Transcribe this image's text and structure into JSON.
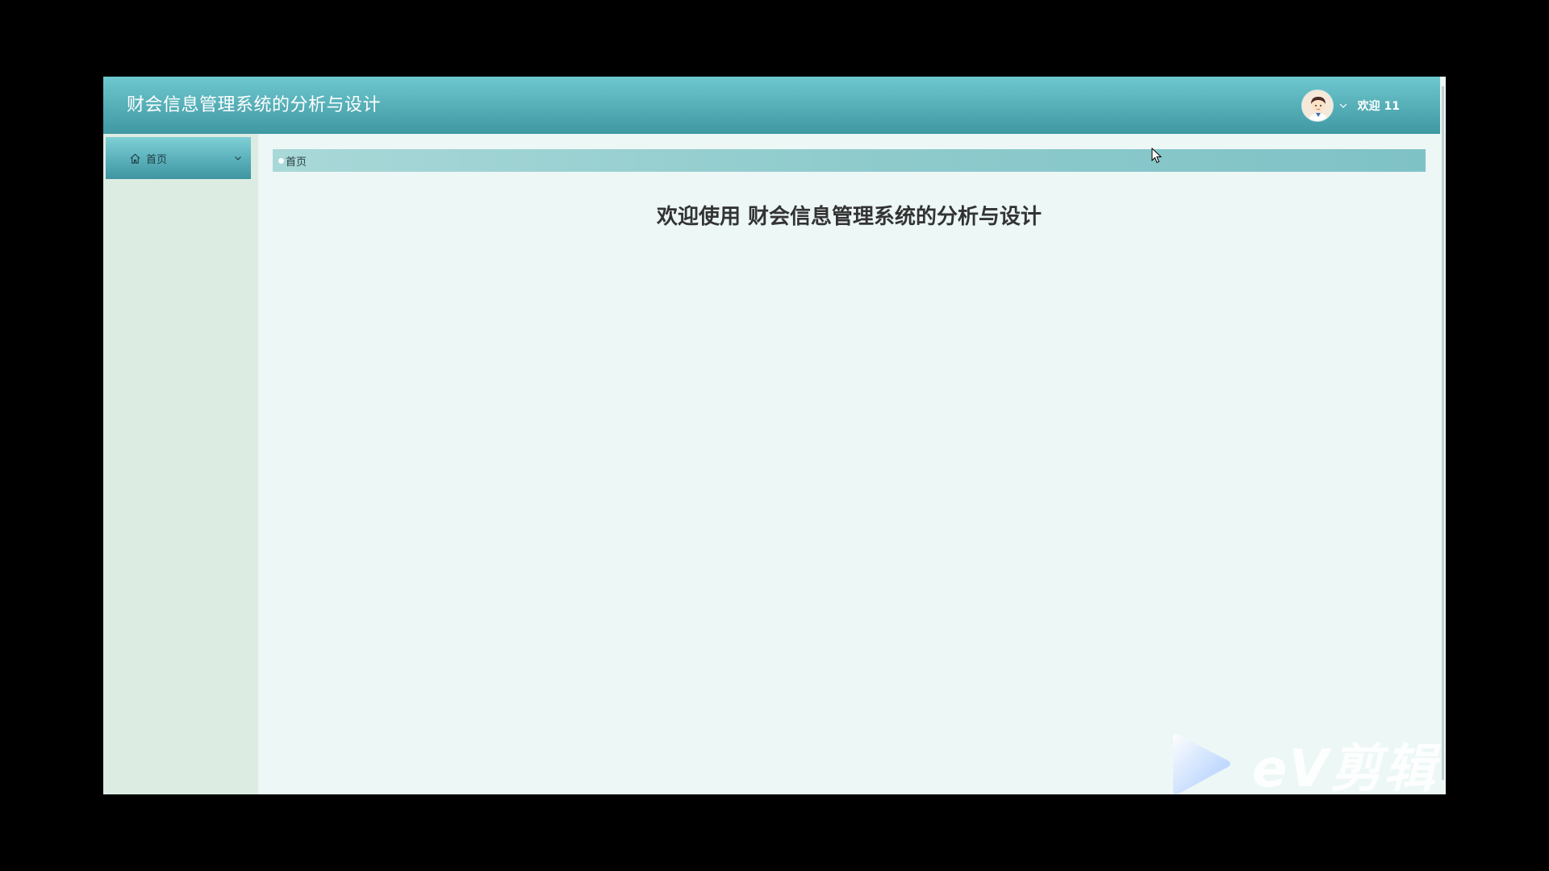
{
  "header": {
    "title": "财会信息管理系统的分析与设计",
    "welcome_user": "欢迎 11",
    "avatar_icon": "user-avatar-icon",
    "user_menu_icon": "chevron-down-icon"
  },
  "sidebar": {
    "items": [
      {
        "label": "首页",
        "icon": "home-icon",
        "expand_icon": "chevron-down-icon"
      }
    ]
  },
  "main": {
    "breadcrumb": "首页",
    "welcome_heading": "欢迎使用 财会信息管理系统的分析与设计"
  },
  "watermark": {
    "text": "eV剪辑",
    "icon": "play-icon"
  },
  "colors": {
    "header": "#55adb6",
    "sidebar": "#dcece2",
    "main": "#ecf7f6",
    "heading_text": "#333333"
  }
}
